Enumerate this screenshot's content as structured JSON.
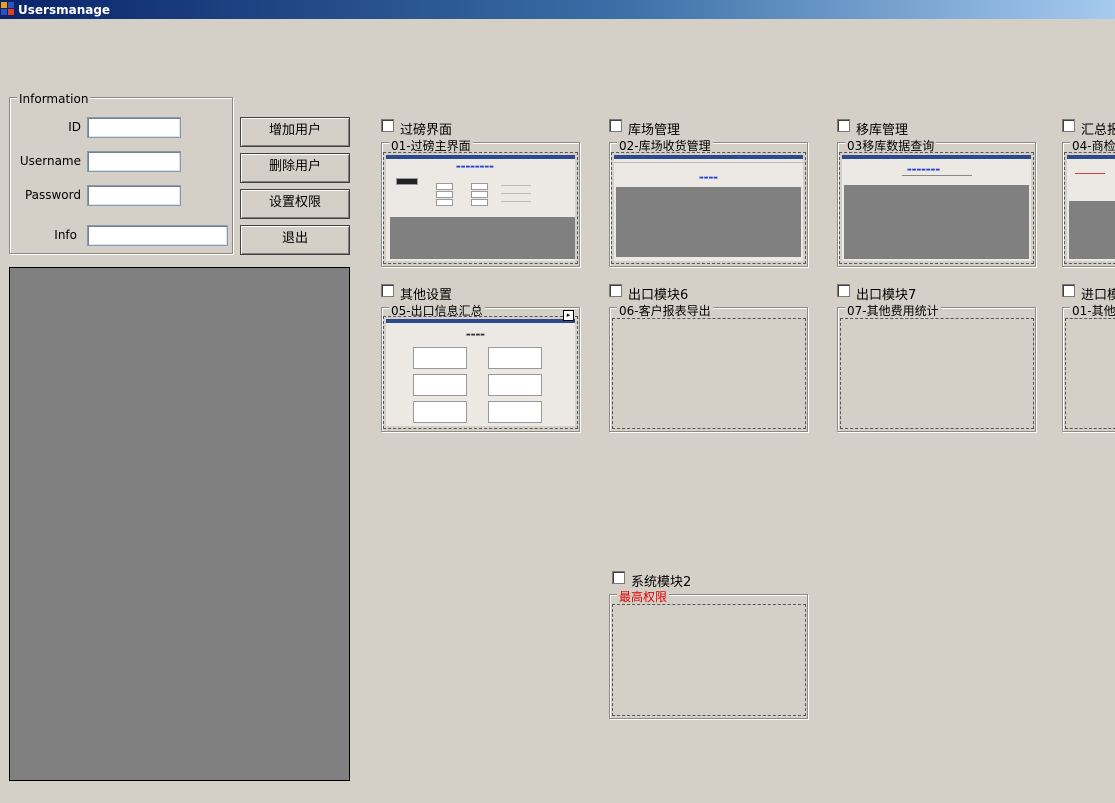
{
  "window": {
    "title": "Usersmanage"
  },
  "information": {
    "group_label": "Information",
    "id_label": "ID",
    "username_label": "Username",
    "password_label": "Password",
    "info_label": "Info",
    "id_value": "",
    "username_value": "",
    "password_value": "",
    "info_value": ""
  },
  "buttons": {
    "add_user": "增加用户",
    "delete_user": "删除用户",
    "set_permission": "设置权限",
    "exit": "退出"
  },
  "modules": [
    {
      "checkbox": "过磅界面",
      "group": "01-过磅主界面",
      "checked": false
    },
    {
      "checkbox": "库场管理",
      "group": "02-库场收货管理",
      "checked": false
    },
    {
      "checkbox": "移库管理",
      "group": "03移库数据查询",
      "checked": false
    },
    {
      "checkbox": "汇总报",
      "group": "04-商检",
      "checked": false
    },
    {
      "checkbox": "其他设置",
      "group": "05-出口信息汇总",
      "checked": false
    },
    {
      "checkbox": "出口模块6",
      "group": "06-客户报表导出",
      "checked": false
    },
    {
      "checkbox": "出口模块7",
      "group": "07-其他费用统计",
      "checked": false
    },
    {
      "checkbox": "进口模",
      "group": "01-其他",
      "checked": false
    },
    {
      "checkbox": "系统模块2",
      "group": "最高权限",
      "checked": false
    }
  ],
  "colors": {
    "title_start": "#0a246a",
    "title_end": "#a6caf0",
    "form_bg": "#d4d0c8",
    "panel_gray": "#808080",
    "warning_red": "#e00000"
  }
}
